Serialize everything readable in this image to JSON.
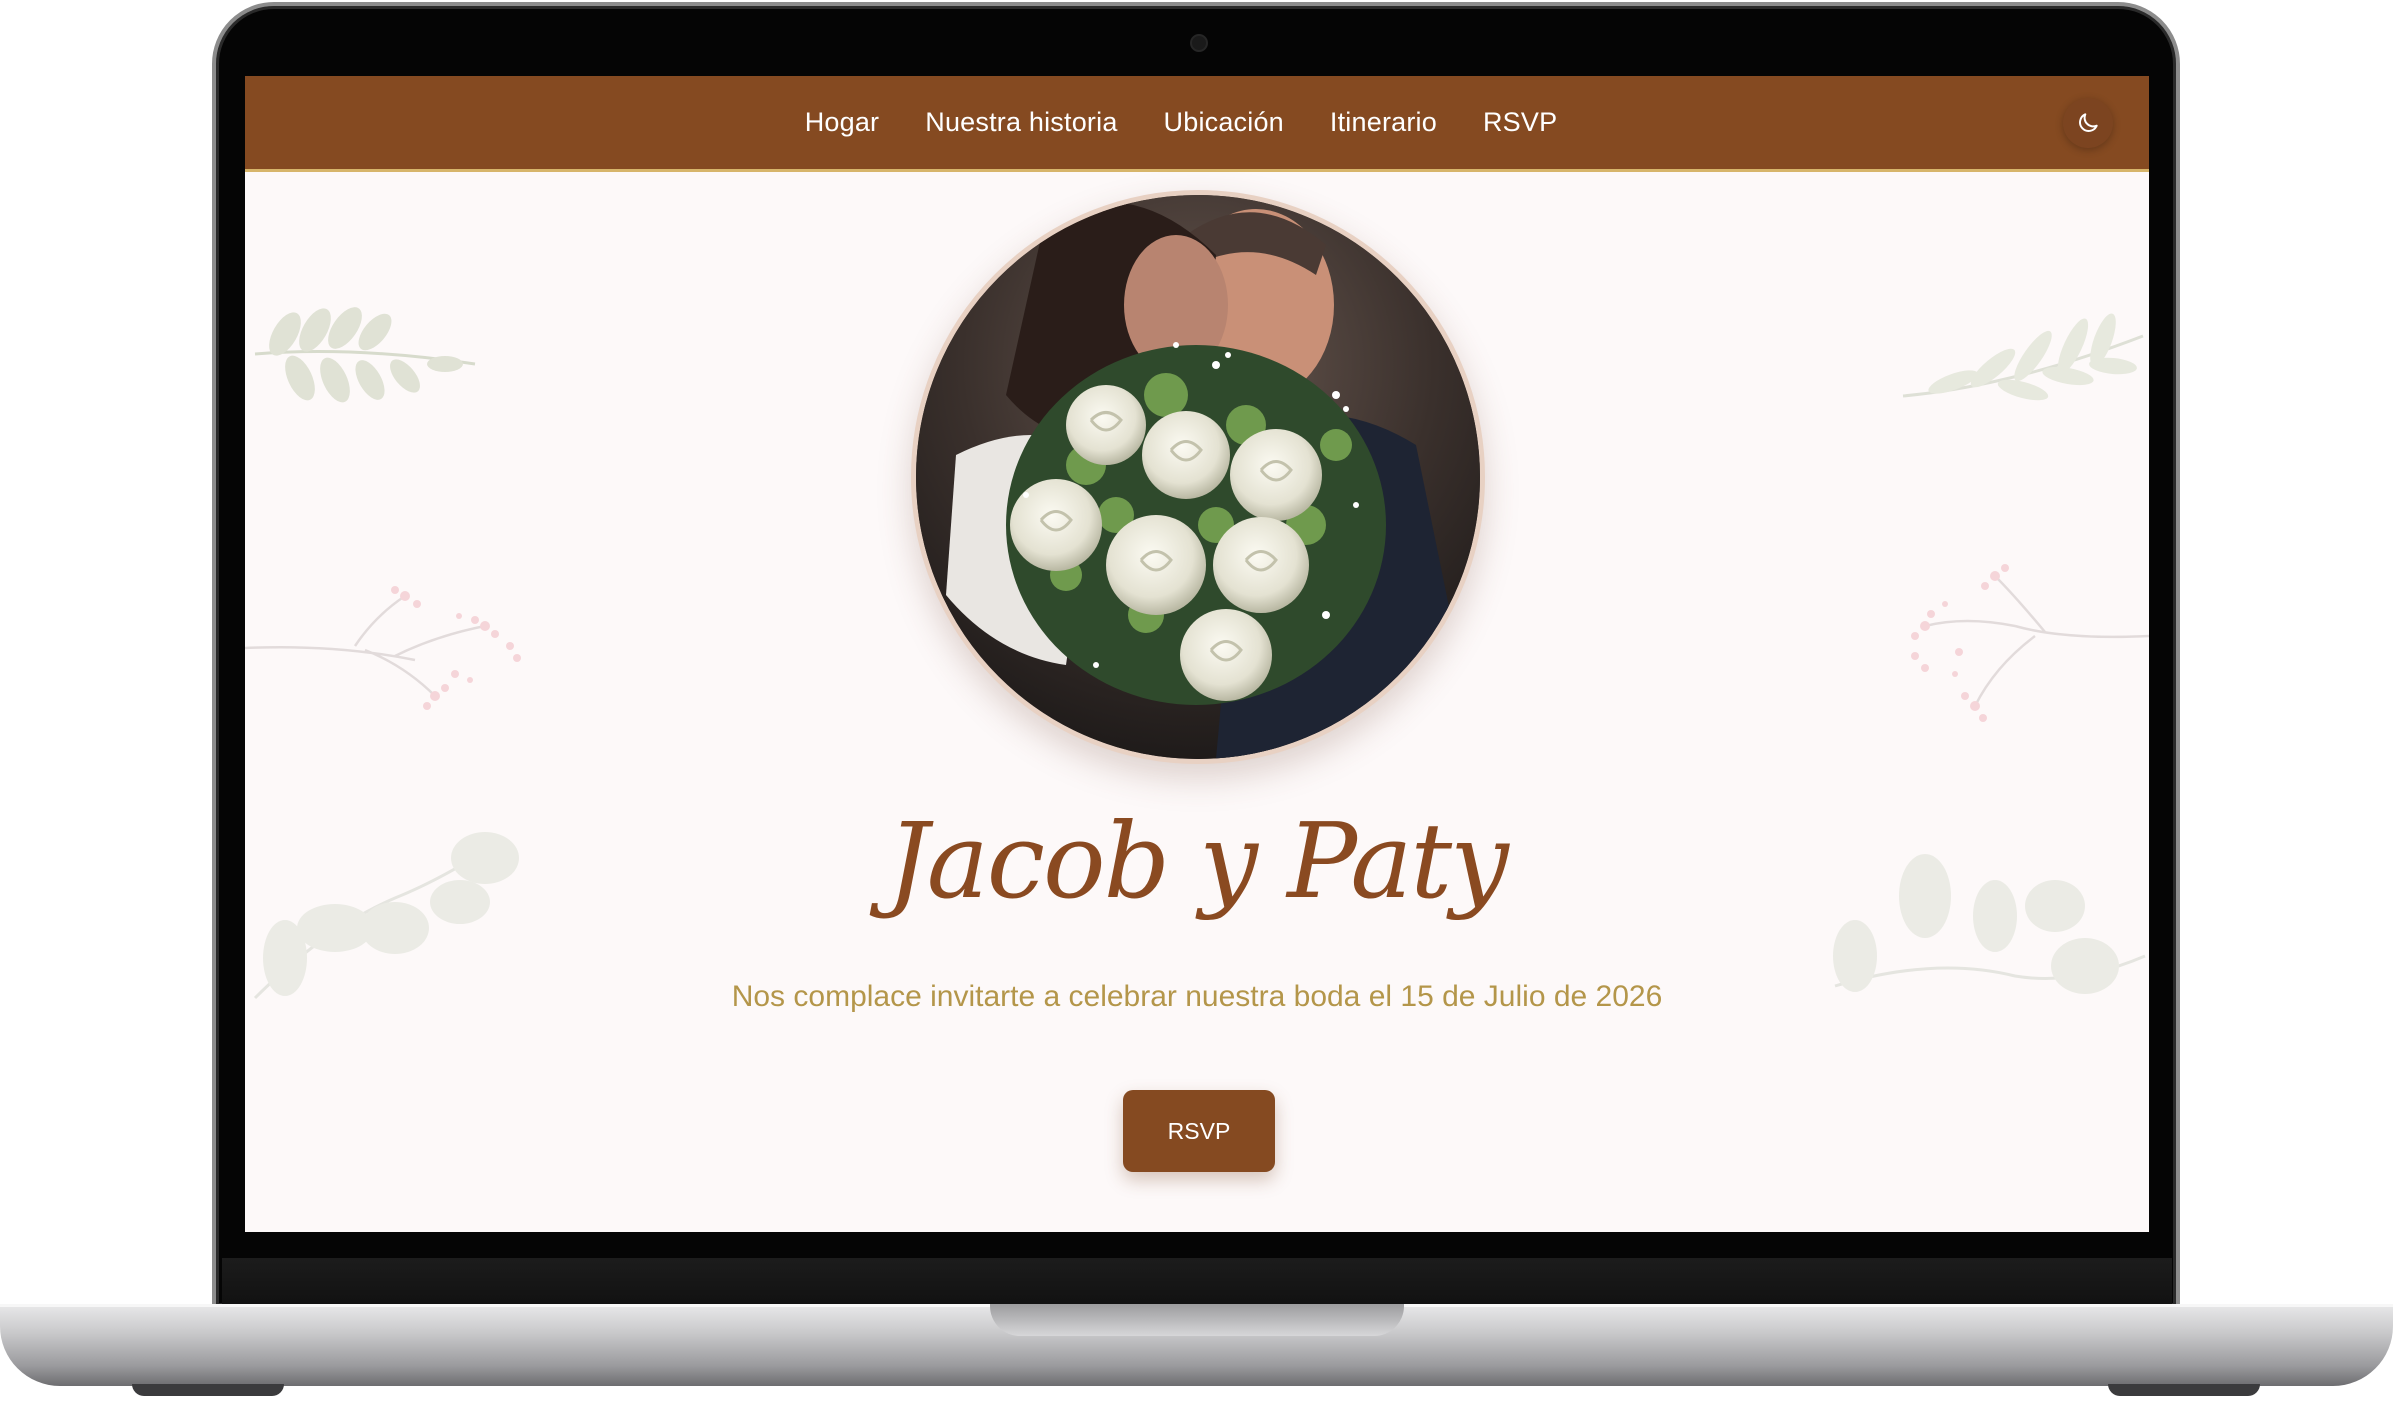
{
  "nav": {
    "links": [
      {
        "label": "Hogar"
      },
      {
        "label": "Nuestra historia"
      },
      {
        "label": "Ubicación"
      },
      {
        "label": "Itinerario"
      },
      {
        "label": "RSVP"
      }
    ],
    "theme_toggle_icon": "moon-icon"
  },
  "hero": {
    "names": "Jacob y Paty",
    "subtitle": "Nos complace invitarte a celebrar nuestra boda el 15 de Julio de 2026",
    "rsvp_label": "RSVP",
    "photo": "bride-groom-bouquet-photo"
  },
  "colors": {
    "primary": "#854a21",
    "accent_gold": "#b4964a",
    "background": "#fdf9f9"
  }
}
